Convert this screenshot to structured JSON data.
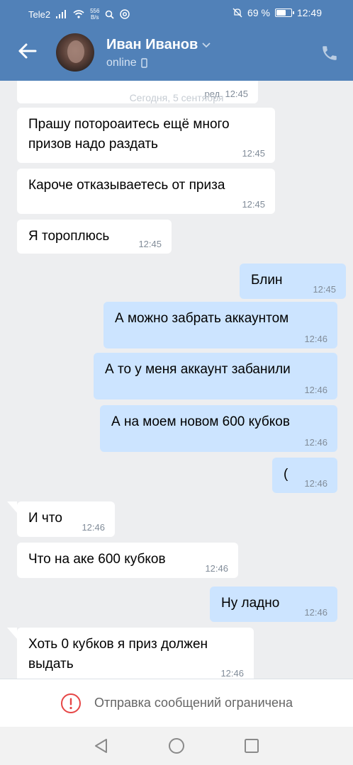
{
  "status_bar": {
    "carrier": "Tele2",
    "speed_value": "556",
    "speed_unit": "B/s",
    "battery": "69 %",
    "battery_level": 0.69,
    "time": "12:49"
  },
  "header": {
    "name": "Иван Иванов",
    "status": "online"
  },
  "chat": {
    "top_partial": {
      "time": "ред. 12:45"
    },
    "date_label": "Сегодня, 5 сентября",
    "messages": [
      {
        "dir": "in",
        "text": "Прашу потороаитесь ещё много\nпризов надо раздать",
        "time": "12:45"
      },
      {
        "dir": "in",
        "text": "Кароче отказываетесь от приза",
        "time": "12:45"
      },
      {
        "dir": "in",
        "text": "Я тороплюсь",
        "time": "12:45"
      },
      {
        "dir": "out",
        "text": "Блин",
        "time": "12:45"
      },
      {
        "dir": "out",
        "text": "А можно забрать аккаунтом",
        "time": "12:46"
      },
      {
        "dir": "out",
        "text": "А то у меня аккаунт забанили",
        "time": "12:46"
      },
      {
        "dir": "out",
        "text": "А на моем новом 600 кубков",
        "time": "12:46"
      },
      {
        "dir": "out",
        "text": "(",
        "time": "12:46"
      },
      {
        "dir": "in",
        "text": "И что",
        "time": "12:46"
      },
      {
        "dir": "in",
        "text": "Что на аке 600 кубков",
        "time": "12:46"
      },
      {
        "dir": "out",
        "text": "Ну ладно",
        "time": "12:46"
      },
      {
        "dir": "in",
        "text": "Хоть 0 кубков я приз должен\nвыдать",
        "time": "12:46"
      }
    ]
  },
  "restricted": {
    "text": "Отправка сообщений ограничена"
  },
  "colors": {
    "header": "#5181b8",
    "incoming": "#ffffff",
    "outgoing": "#cce4ff",
    "background": "#edeef0",
    "warning": "#e64646"
  }
}
